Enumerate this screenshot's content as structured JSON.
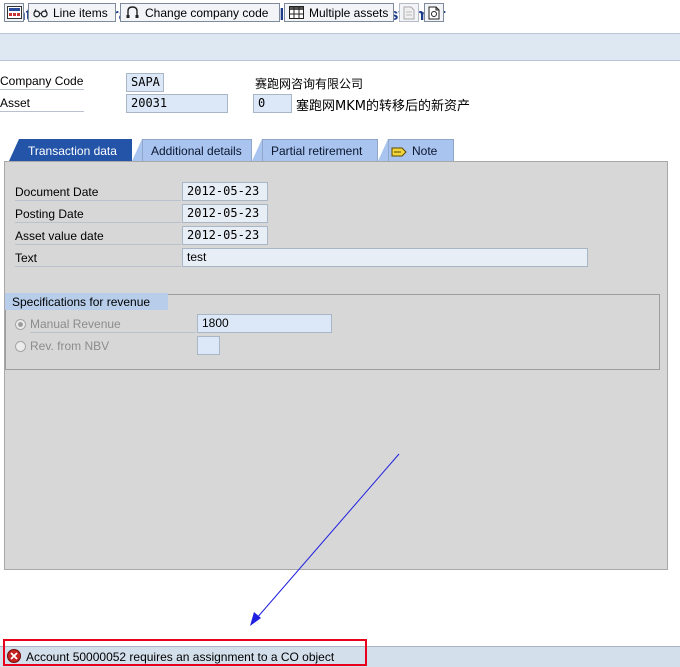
{
  "window": {
    "title": "Enter Asset Transaction: Asset Sale Without Customer"
  },
  "toolbar": {
    "line_items": {
      "label": "Line items",
      "icon": "glasses-icon"
    },
    "change_company_code": {
      "label": "Change company code",
      "icon": "key-icon"
    },
    "multiple_assets": {
      "label": "Multiple assets",
      "icon": "grid-icon"
    }
  },
  "header": {
    "company_code_label": "Company Code",
    "company_code_value": "SAPA",
    "company_name": "赛跑网咨询有限公司",
    "asset_label": "Asset",
    "asset_value": "20031",
    "sub_number": "0",
    "asset_description": "塞跑网MKM的转移后的新资产"
  },
  "tabs": [
    {
      "label": "Transaction data",
      "active": true
    },
    {
      "label": "Additional details",
      "active": false
    },
    {
      "label": "Partial retirement",
      "active": false
    },
    {
      "label": "Note",
      "active": false
    }
  ],
  "transaction": {
    "document_date_label": "Document Date",
    "document_date": "2012-05-23",
    "posting_date_label": "Posting Date",
    "posting_date": "2012-05-23",
    "asset_value_date_label": "Asset value date",
    "asset_value_date": "2012-05-23",
    "text_label": "Text",
    "text": "test"
  },
  "revenue": {
    "group_title": "Specifications for revenue",
    "manual_revenue_label": "Manual Revenue",
    "manual_revenue_value": "1800",
    "manual_revenue_selected": true,
    "rev_from_nbv_label": "Rev. from NBV"
  },
  "status": {
    "type": "error",
    "message": "Account 50000052 requires an assignment to a CO object"
  },
  "colors": {
    "title": "#1c3a8a",
    "active_tab": "#2354a8",
    "inactive_tab": "#a9c4ee",
    "highlight_box": "#e8001c",
    "annotation_arrow": "#2020e0"
  }
}
